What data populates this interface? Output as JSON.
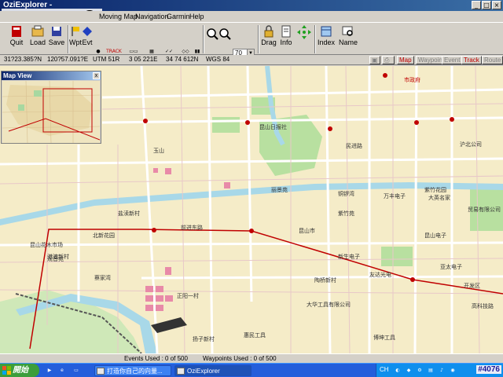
{
  "window": {
    "title": "OziExplorer -",
    "minimize": "_",
    "maximize": "□",
    "close": "×"
  },
  "menu": [
    "Moving Map",
    "Navigation",
    "Garmin",
    "Help"
  ],
  "toolbar": {
    "quit": "Quit",
    "load": "Load",
    "save": "Save",
    "wpt": "Wpt",
    "evt": "Evt",
    "trk": "TRACK",
    "zoom_value": "70",
    "drag": "Drag",
    "info": "Info",
    "index": "Index",
    "name": "Name"
  },
  "coords": {
    "lat": "31?23.385?N",
    "lon": "120?57.091?E",
    "utm": "UTM  51R",
    "easting": "3 05 221E",
    "northing": "34 74 612N",
    "datum": "WGS 84"
  },
  "view_tabs": [
    {
      "label": "Map",
      "active": true
    },
    {
      "label": "Waypoint",
      "active": false
    },
    {
      "label": "Event",
      "active": false
    },
    {
      "label": "Track",
      "active": true
    },
    {
      "label": "Route",
      "active": false
    }
  ],
  "map_view": {
    "title": "Map View",
    "close": "x"
  },
  "map_labels": {
    "l1": "市政府",
    "l2": "昆山日报社",
    "l3": "民进路",
    "l4": "沪北公司",
    "l5": "港澳新村",
    "l6": "北新花园",
    "l7": "盐渎新村",
    "l8": "万丰电子",
    "l9": "大英名家",
    "l10": "紫竹花园",
    "l11": "贸易有限公司",
    "l12": "前进东路",
    "l13": "昆山花木市场",
    "l14": "昆山电子",
    "l15": "紫竹苑",
    "l16": "正阳一村",
    "l17": "蔡家湾",
    "l18": "观音苑",
    "l19": "友达光电",
    "l20": "铜锣湾",
    "l21": "大华工具有限公司",
    "l22": "新生电子",
    "l23": "亚太电子",
    "l24": "开发区",
    "l25": "昆山市",
    "l26": "惠民工具",
    "l27": "博坤工具",
    "l28": "高科技路",
    "l29": "扬子新村",
    "l30": "陶桥新村",
    "l31": "丽景苑",
    "l32": "玉山"
  },
  "status": {
    "events": "Events Used : 0 of 500",
    "waypoints": "Waypoints Used : 0 of 500"
  },
  "taskbar": {
    "start": "開始",
    "tasks": [
      "打造你自己的向量...",
      "OziExplorer"
    ],
    "tray_cb": "CH",
    "clock": "#4076"
  },
  "colors": {
    "title_bar": "#0a246a",
    "map_base": "#f5ecc8",
    "track_line": "#c00000",
    "river": "#a8d8e8",
    "green_area": "#b8e0a0"
  }
}
